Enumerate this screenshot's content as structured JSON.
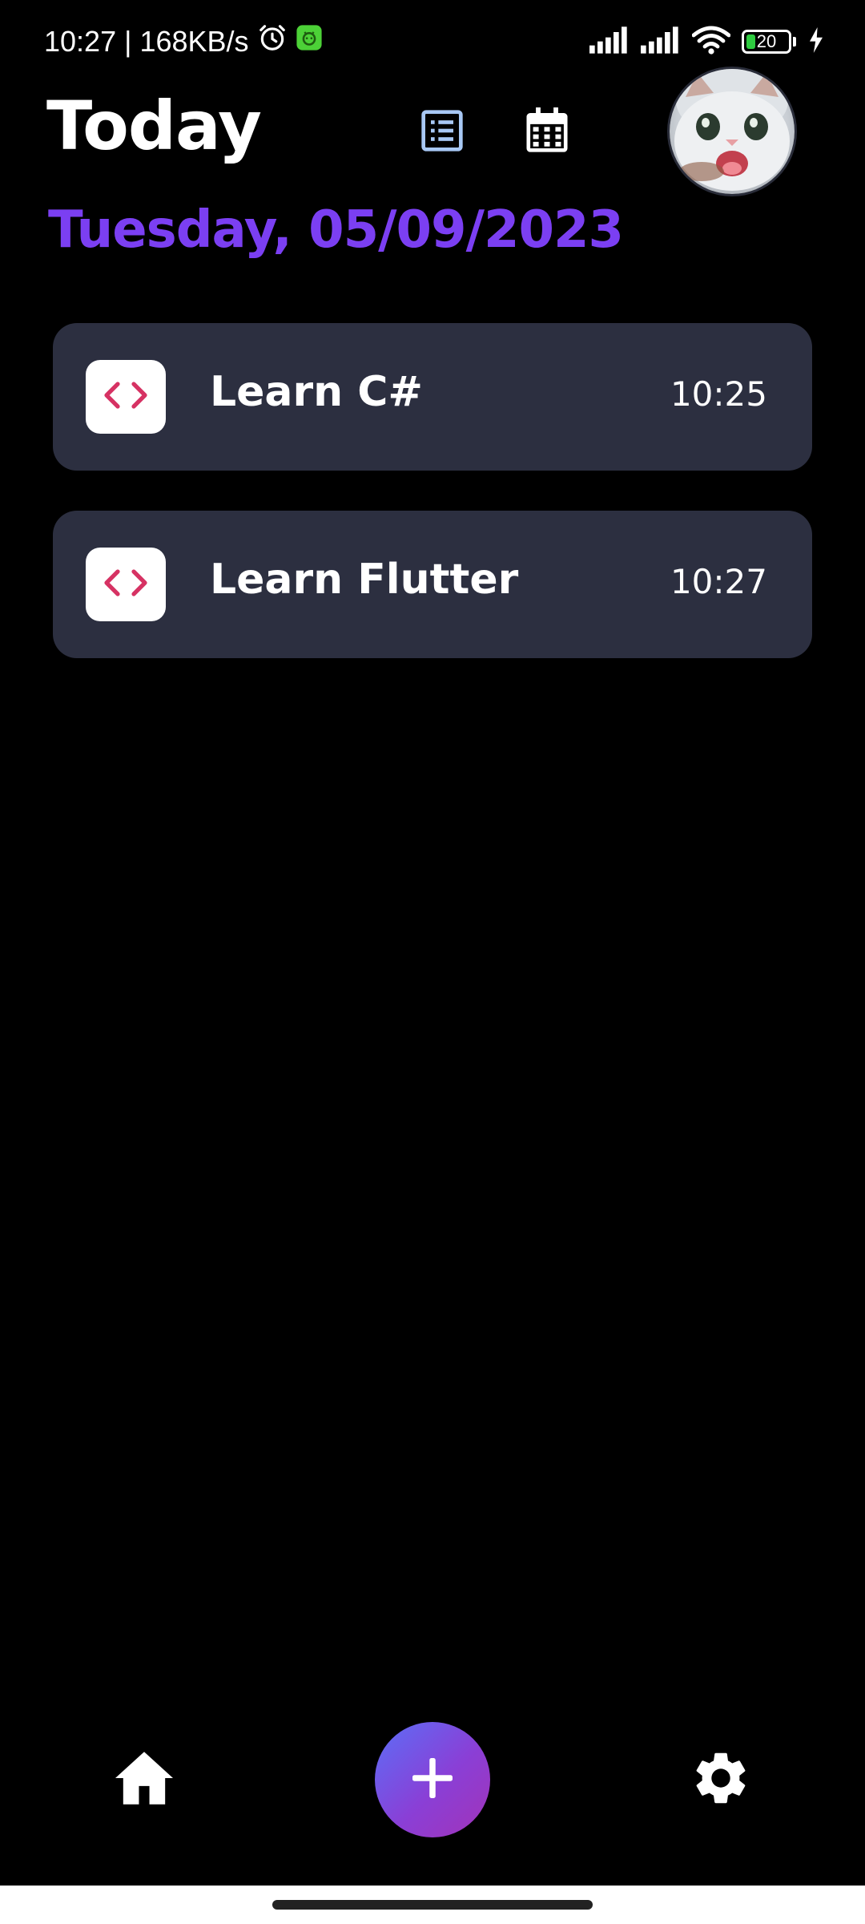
{
  "status_bar": {
    "time_speed": "10:27 | 168KB/s",
    "battery_level": "20",
    "battery_percent": 0.2,
    "icons": [
      "alarm-icon",
      "app-notification-icon",
      "signal-icon",
      "signal-icon",
      "wifi-icon",
      "battery-icon",
      "charging-icon"
    ]
  },
  "header": {
    "title": "Today",
    "list_view_icon": "list-icon",
    "calendar_view_icon": "calendar-icon",
    "avatar": "user-avatar",
    "accent_list_icon_color": "#a8c8f5"
  },
  "date_label": "Tuesday, 05/09/2023",
  "date_color": "#7b3ff2",
  "tasks": [
    {
      "title": "Learn C#",
      "time": "10:25",
      "icon": "code-icon"
    },
    {
      "title": "Learn Flutter",
      "time": "10:27",
      "icon": "code-icon"
    }
  ],
  "colors": {
    "card_bg": "#2c2f40",
    "code_icon": "#d63263",
    "fab_gradient_start": "#5b6ff7",
    "fab_gradient_end": "#a233b8"
  },
  "bottom_nav": {
    "home_icon": "home-icon",
    "add_icon": "plus-icon",
    "settings_icon": "gear-icon"
  }
}
